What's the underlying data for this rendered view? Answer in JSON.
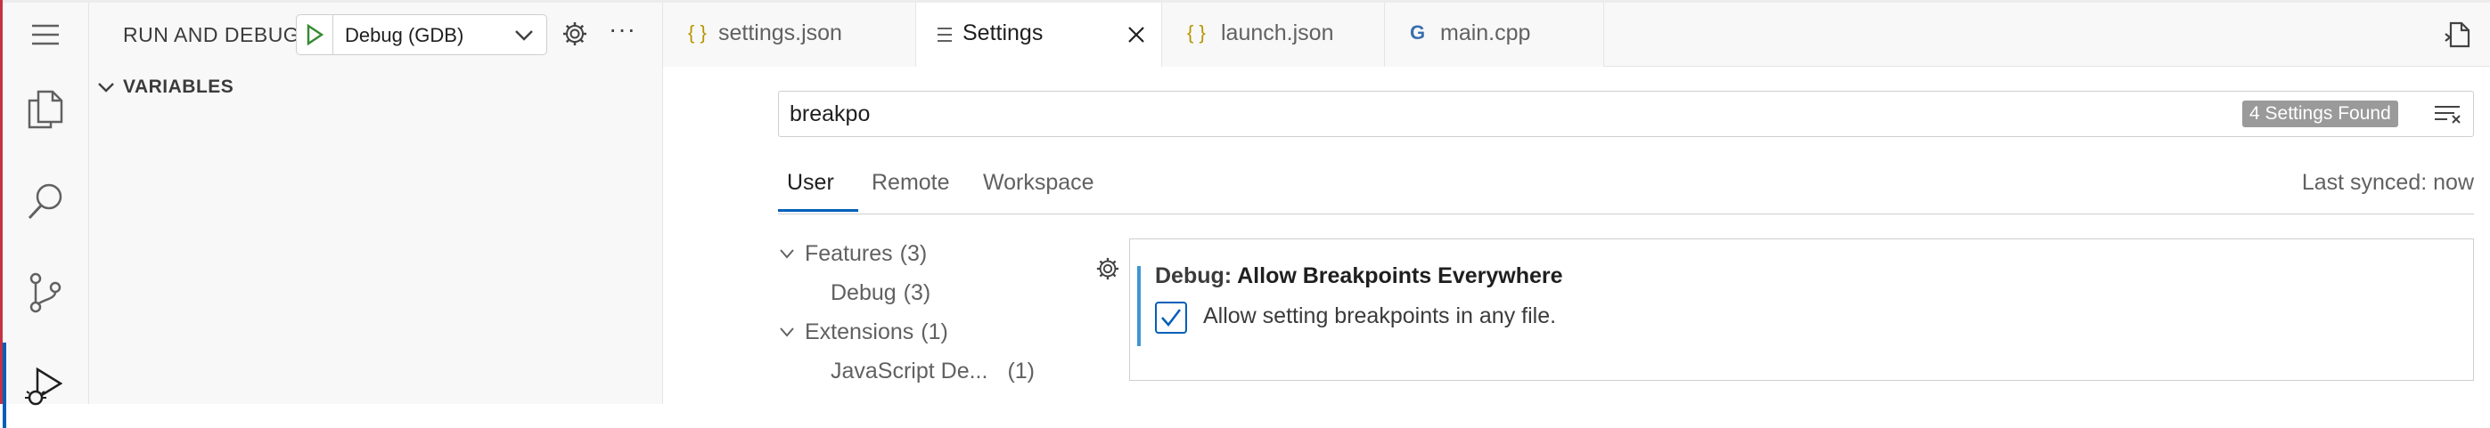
{
  "colors": {
    "accent": "#005fb8",
    "badge_bg": "#9a9a9a",
    "json_icon": "#b89500",
    "cpp_icon": "#3a6fae"
  },
  "activity_bar": {
    "items": [
      {
        "icon": "menu-icon"
      },
      {
        "icon": "explorer-icon"
      },
      {
        "icon": "search-icon"
      },
      {
        "icon": "source-control-icon"
      },
      {
        "icon": "run-and-debug-icon",
        "active": true
      }
    ]
  },
  "sidebar": {
    "title": "RUN AND DEBUG",
    "configuration": "Debug (GDB)",
    "section_title": "VARIABLES"
  },
  "tabs": [
    {
      "label": "settings.json",
      "icon_text": "{ }",
      "icon": "json-icon"
    },
    {
      "label": "Settings",
      "icon": "settings-file-icon",
      "active": true
    },
    {
      "label": "launch.json",
      "icon_text": "{ }",
      "icon": "json-icon"
    },
    {
      "label": "main.cpp",
      "icon_text": "G",
      "icon": "cpp-icon"
    }
  ],
  "settings": {
    "search_value": "breakpo",
    "found_label": "4 Settings Found",
    "scope_tabs": [
      "User",
      "Remote",
      "Workspace"
    ],
    "last_synced": "Last synced: now",
    "toc": [
      {
        "label": "Features",
        "count": "(3)",
        "expanded": true,
        "level": 0
      },
      {
        "label": "Debug",
        "count": "(3)",
        "level": 1
      },
      {
        "label": "Extensions",
        "count": "(1)",
        "expanded": true,
        "level": 0
      },
      {
        "label": "JavaScript De...",
        "count": "(1)",
        "level": 1
      }
    ],
    "setting": {
      "category": "Debug: ",
      "name": "Allow Breakpoints Everywhere",
      "description": "Allow setting breakpoints in any file.",
      "checked": true
    }
  }
}
